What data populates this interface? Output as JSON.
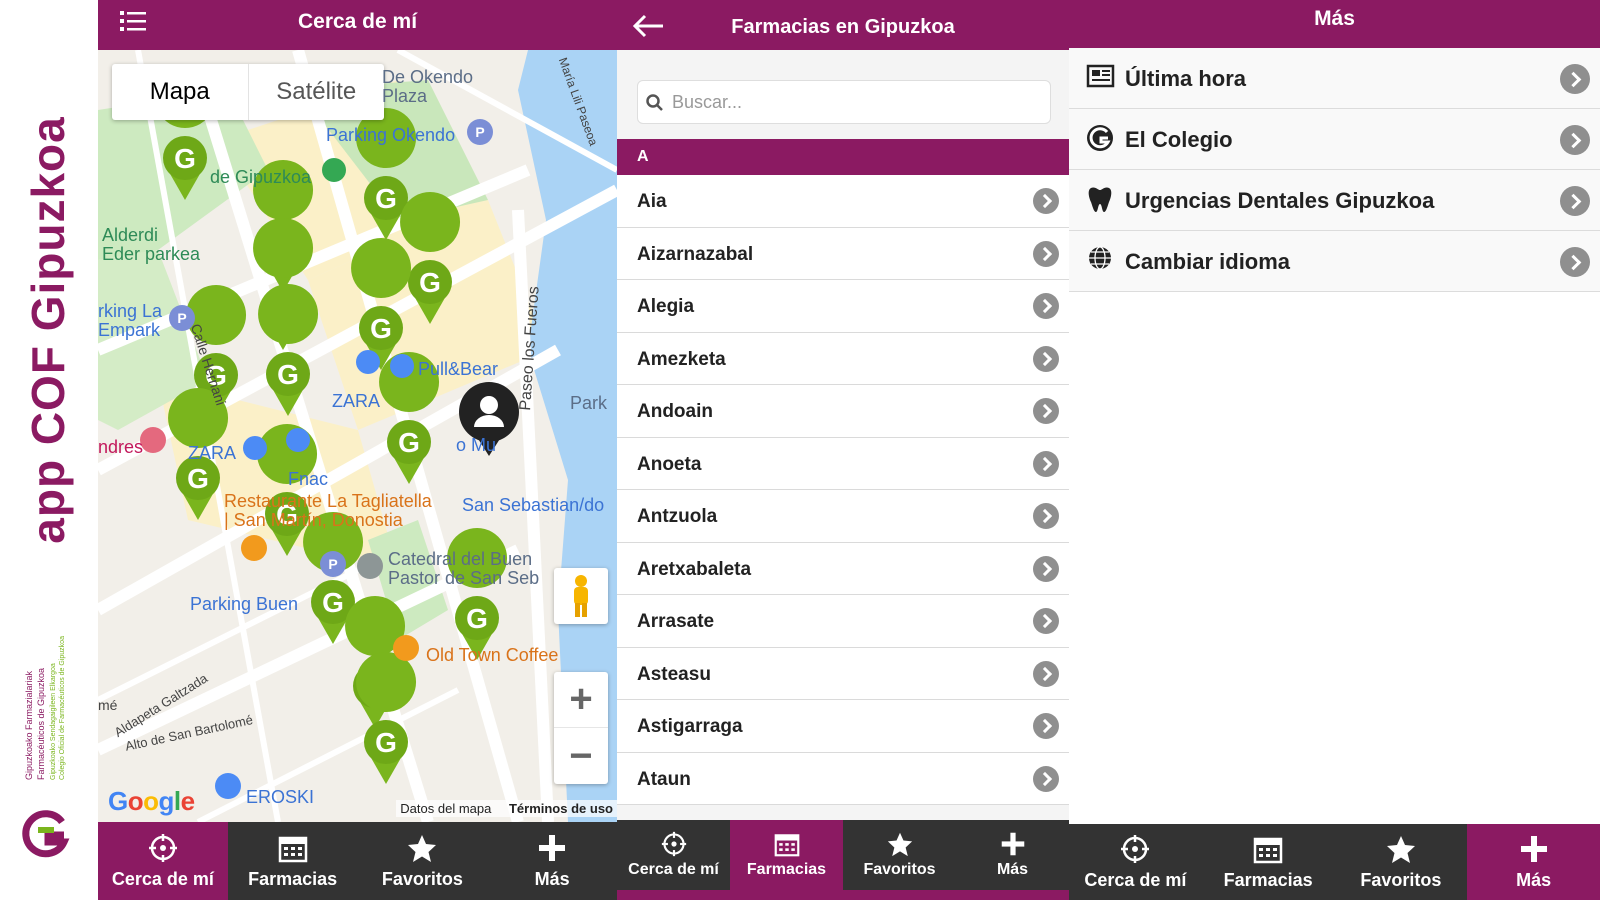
{
  "brand": {
    "title": "app COF Gipuzkoa",
    "org_eu": "Gipuzkoako Farmazialariak",
    "org_es": "Farmacéuticos de Gipuzkoa",
    "org_eu_full": "Gipuzkoako Sendagaigileen Elkargoa",
    "org_es_full": "Colegio Oficial de Farmacéuticos de Gipuzkoa",
    "color": "#8b1a62",
    "accent": "#7ab51d"
  },
  "screen1": {
    "title": "Cerca de mí",
    "menu_icon": "list-menu-icon",
    "map_toggle": {
      "map": "Mapa",
      "satellite": "Satélite",
      "selected": "Mapa"
    },
    "labels": {
      "okendo": "De Okendo\nPlaza",
      "parking_okendo": "Parking Okendo",
      "gipuzkoa": "de Gipuzkoa",
      "alderdi": "Alderdi\nEder parkea",
      "parking_la": "rking La\nEmpark",
      "calle": "Calle Hernani",
      "pullbear": "Pull&Bear",
      "zara": "ZARA",
      "zara2": "ZARA",
      "fnac": "Fnac",
      "andres": "ndres",
      "restaurant": "Restaurante La Tagliatella\n| San Martín, Donostia",
      "donostia": "o Mu",
      "sansebastian": "San Sebastian/do",
      "park": "Park",
      "paseo": "Paseo los Fueros",
      "maria": "María Lili Paseoa",
      "catedral": "Catedral del Buen\nPastor de San Seb",
      "parking_buen": "Parking Buen",
      "oldtown": "Old Town Coffee",
      "aldapeta": "Aldapeta Galtzada",
      "alto": "Alto de San Bartolomé",
      "eroski": "EROSKI",
      "ome": "mé"
    },
    "google": "Google",
    "attribution": {
      "data": "Datos del mapa",
      "terms": "Términos de uso"
    }
  },
  "screen2": {
    "title": "Farmacias en Gipuzkoa",
    "search_placeholder": "Buscar...",
    "section": "A",
    "items": [
      "Aia",
      "Aizarnazabal",
      "Alegia",
      "Amezketa",
      "Andoain",
      "Anoeta",
      "Antzuola",
      "Aretxabaleta",
      "Arrasate",
      "Asteasu",
      "Astigarraga",
      "Ataun"
    ]
  },
  "screen3": {
    "title": "Más",
    "items": [
      {
        "label": "Última hora",
        "icon": "newspaper-icon"
      },
      {
        "label": "El Colegio",
        "icon": "cof-logo-icon"
      },
      {
        "label": "Urgencias Dentales Gipuzkoa",
        "icon": "tooth-icon"
      },
      {
        "label": "Cambiar idioma",
        "icon": "globe-icon"
      }
    ]
  },
  "tabs": [
    {
      "label": "Cerca de mí",
      "icon": "crosshair-icon"
    },
    {
      "label": "Farmacias",
      "icon": "calendar-icon"
    },
    {
      "label": "Favoritos",
      "icon": "star-icon"
    },
    {
      "label": "Más",
      "icon": "plus-icon"
    }
  ],
  "active_tab": {
    "screen1": "Cerca de mí",
    "screen2": "Farmacias",
    "screen3": "Más"
  }
}
